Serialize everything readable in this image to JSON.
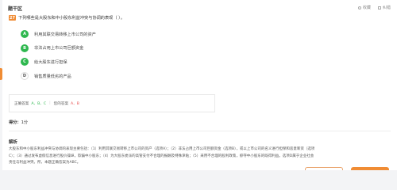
{
  "header": {
    "section_title": "题干区",
    "favorite_label": "收藏",
    "correct_error_label": "纠错"
  },
  "question": {
    "number": "27",
    "text": "下列哪些是大股东和中小股东利益冲突与协调的表现（ ）。"
  },
  "options": [
    {
      "letter": "A",
      "text": "利用其联交易转移上市公司的资产",
      "selected": true
    },
    {
      "letter": "B",
      "text": "非法占用上市公司巨额资金",
      "selected": true
    },
    {
      "letter": "C",
      "text": "给大股东进行担保",
      "selected": true
    },
    {
      "letter": "D",
      "text": "销售质量低劣的产品",
      "selected": false
    }
  ],
  "answer": {
    "correct_label": "正确答案",
    "correct_value": "A、B、C",
    "mine_label": "您的答案",
    "mine_value": "A、B"
  },
  "score": {
    "label": "得分：",
    "value": "1分"
  },
  "analysis": {
    "title": "解析",
    "lines": [
      "大股东和中小股东利益冲突与协调的表现主要包括：（1）利用其联交易转移上市公司的资产（选项A）；（2）非法占用上市公司巨额资金（选项B），或以上市公司的名义进行担保和恶意筹资（选项",
      "C）；（3）通过发布虚假信息进行股价操纵，欺骗中小股东；（4）为大股东委派的高管支付不合理的报酬及特殊津贴；（5）采用不合理的股利政策，掠夺中小股东的既得利益。选项D属于企业社会",
      "责任与利益冲突。所，本题正确答案为ABC。"
    ]
  },
  "icons": {
    "favorite": "circle-outline-icon",
    "correct_error": "square-outline-icon"
  },
  "colors": {
    "accent": "#f08c34",
    "selected": "#2fb84f",
    "wrong": "#e84d4d"
  }
}
